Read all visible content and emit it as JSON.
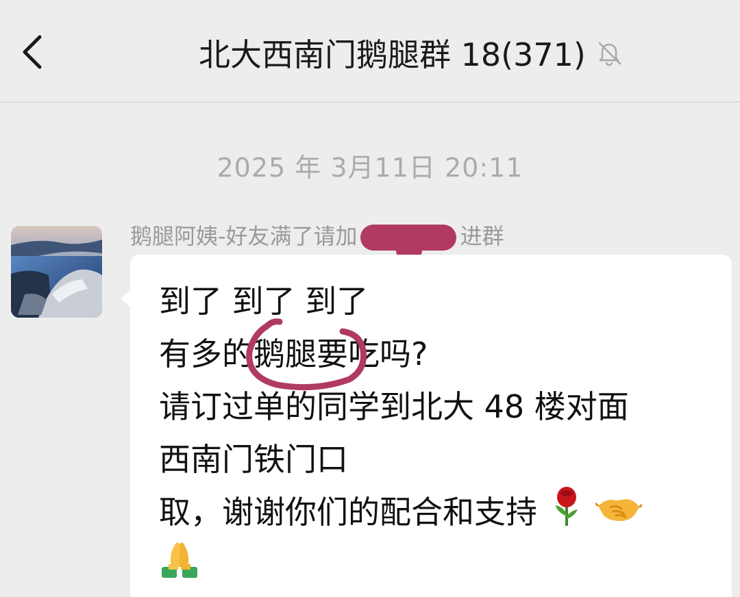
{
  "header": {
    "title": "北大西南门鹅腿群 18(371)",
    "back_icon": "chevron-left-icon",
    "mute_icon": "bell-off-icon"
  },
  "chat": {
    "timestamp": "2025 年 3月11日 20:11",
    "message": {
      "sender_prefix": "鹅腿阿姨-好友满了请加",
      "sender_suffix": "进群",
      "lines": [
        "到了  到了  到了",
        "有多的鹅腿要吃吗?",
        "请订过单的同学到北大 48 楼对面",
        "西南门铁门口",
        "取，谢谢你们的配合和支持"
      ],
      "emojis": [
        "rose-emoji",
        "handshake-emoji",
        "folded-hands-emoji"
      ]
    }
  },
  "colors": {
    "background": "#ededed",
    "bubble": "#ffffff",
    "annotation": "#b03a64",
    "meta_text": "#ababab"
  }
}
